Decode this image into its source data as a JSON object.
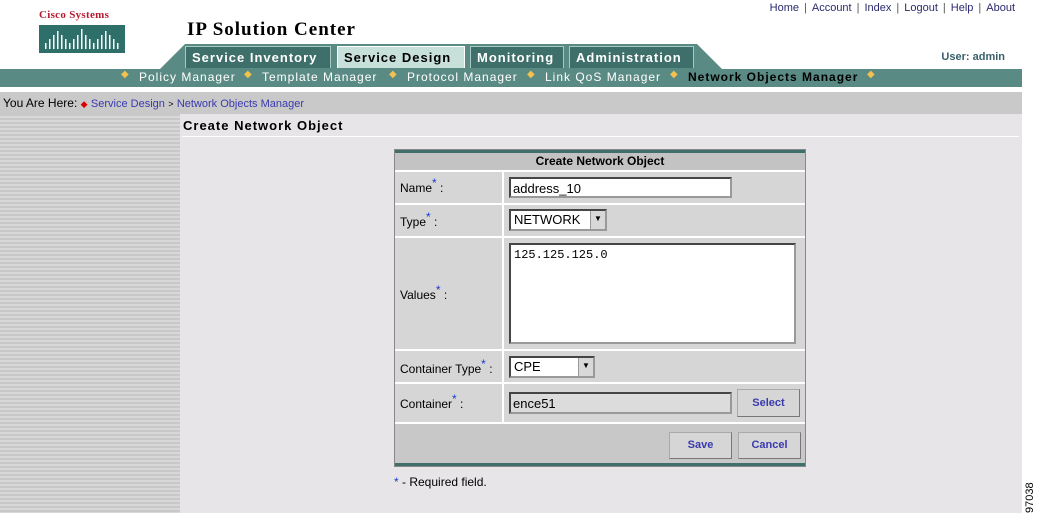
{
  "brand": {
    "logo_text": "Cisco Systems",
    "app_title": "IP Solution Center"
  },
  "top_links": [
    "Home",
    "Account",
    "Index",
    "Logout",
    "Help",
    "About"
  ],
  "user_label": "User: admin",
  "tabs": [
    {
      "label": "Service Inventory",
      "active": false
    },
    {
      "label": "Service Design",
      "active": true
    },
    {
      "label": "Monitoring",
      "active": false
    },
    {
      "label": "Administration",
      "active": false
    }
  ],
  "subnav": [
    {
      "label": "Policy Manager",
      "active": false
    },
    {
      "label": "Template Manager",
      "active": false
    },
    {
      "label": "Protocol Manager",
      "active": false
    },
    {
      "label": "Link QoS Manager",
      "active": false
    },
    {
      "label": "Network Objects Manager",
      "active": true
    }
  ],
  "breadcrumb": {
    "prefix": "You Are Here:",
    "items": [
      "Service Design",
      "Network Objects Manager"
    ]
  },
  "page_title": "Create Network Object",
  "form": {
    "header": "Create Network Object",
    "name_label": "Name",
    "name_value": "address_10",
    "type_label": "Type",
    "type_value": "NETWORK",
    "values_label": "Values",
    "values_value": "125.125.125.0",
    "container_type_label": "Container Type",
    "container_type_value": "CPE",
    "container_label": "Container",
    "container_value": "ence51",
    "select_button": "Select",
    "save_button": "Save",
    "cancel_button": "Cancel",
    "required_star": "*",
    "colon": ":"
  },
  "required_note": "- Required field.",
  "figure_id": "97038",
  "colors": {
    "nav_teal": "#5a8a84",
    "tab_dark": "#3f6f6a",
    "link_blue": "#3a3ab0",
    "cisco_red": "#b8192e"
  }
}
